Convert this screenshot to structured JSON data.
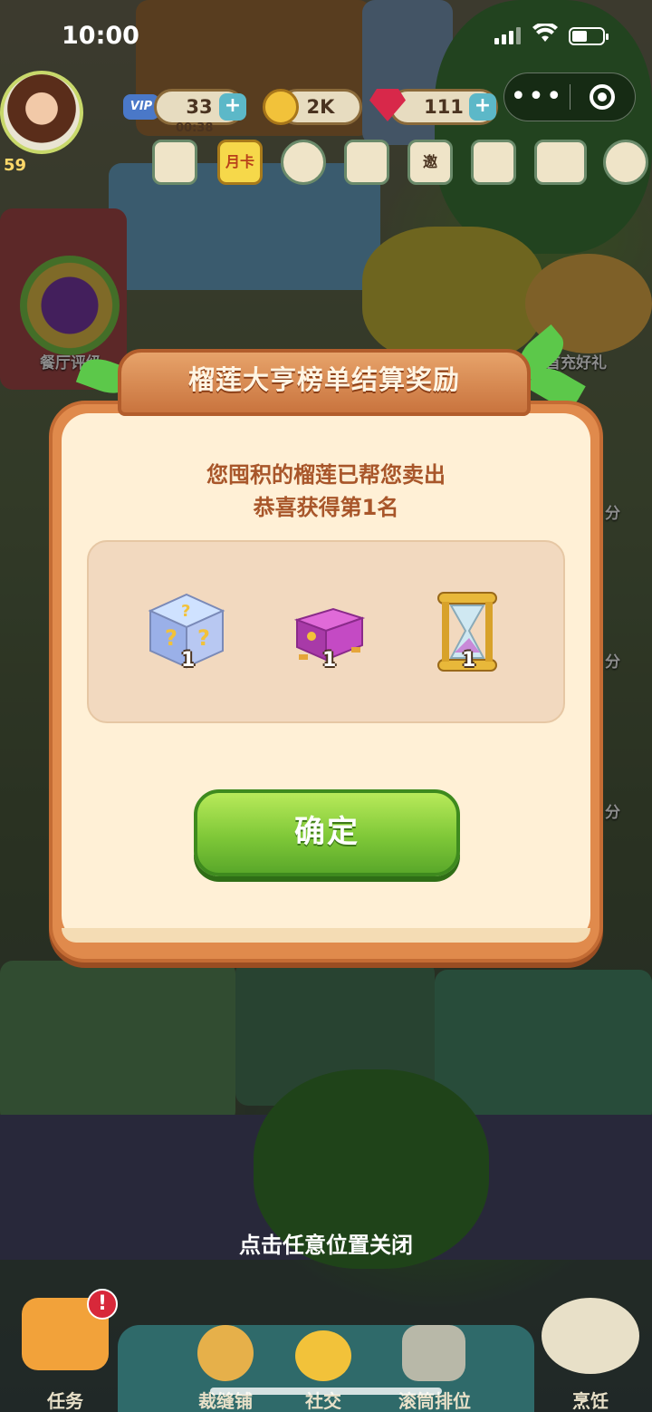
{
  "status_bar": {
    "time": "10:00"
  },
  "capsule": {
    "more_icon": "more-dots-icon",
    "close_icon": "record-circle-icon"
  },
  "hud": {
    "level": "59",
    "vip_badge": "VIP",
    "energy": "33",
    "energy_timer": "00:38",
    "coins": "2K",
    "gems": "111",
    "icons": [
      "vip-crown-icon",
      "monthly-card-icon",
      "chat-icon",
      "calendar-check-icon",
      "invite-icon",
      "book-icon",
      "mail-icon",
      "gear-icon"
    ],
    "monthly_card": "月卡",
    "invite": "邀"
  },
  "side_labels": {
    "restaurant_rating": "餐厅评级",
    "first_recharge": "首充好礼",
    "score_1": "分",
    "score_2": "分",
    "score_3": "分"
  },
  "modal": {
    "title": "榴莲大亨榜单结算奖励",
    "line1": "您囤积的榴莲已帮您卖出",
    "line2": "恭喜获得第1名",
    "rewards": [
      {
        "icon": "mystery-cube-icon",
        "qty": "1"
      },
      {
        "icon": "purple-chest-icon",
        "qty": "1"
      },
      {
        "icon": "hourglass-icon",
        "qty": "1"
      }
    ],
    "confirm": "确定"
  },
  "close_hint": "点击任意位置关闭",
  "nav": {
    "items": [
      {
        "label": "任务",
        "icon": "task-clipboard-icon"
      },
      {
        "label": "裁缝铺",
        "icon": "sewing-icon"
      },
      {
        "label": "社交",
        "icon": "duck-icon"
      },
      {
        "label": "滚筒排位",
        "icon": "trophy-icon"
      },
      {
        "label": "烹饪",
        "icon": "cooking-pot-icon"
      }
    ],
    "alert": "!"
  },
  "colors": {
    "modal_orange": "#e08a4c",
    "modal_cream": "#fff0d6",
    "confirm_green": "#7fc838",
    "title_text": "#a8562a"
  }
}
